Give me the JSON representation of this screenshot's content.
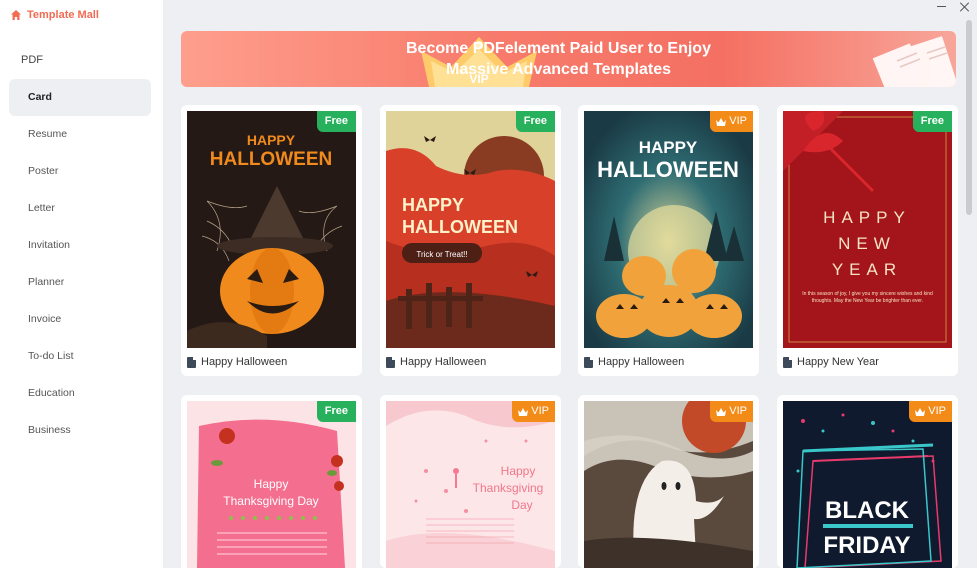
{
  "app": {
    "title": "Template Mall"
  },
  "sidebar": {
    "section": "PDF",
    "items": [
      {
        "label": "Card",
        "active": true
      },
      {
        "label": "Resume"
      },
      {
        "label": "Poster"
      },
      {
        "label": "Letter"
      },
      {
        "label": "Invitation"
      },
      {
        "label": "Planner"
      },
      {
        "label": "Invoice"
      },
      {
        "label": "To-do List"
      },
      {
        "label": "Education"
      },
      {
        "label": "Business"
      }
    ]
  },
  "banner": {
    "line1": "Become PDFelement Paid User to Enjoy",
    "line2": "Massive Advanced Templates",
    "crown_text": "VIP"
  },
  "badges": {
    "free": "Free",
    "vip": "VIP"
  },
  "cards": [
    {
      "title": "Happy Halloween",
      "badge": "Free",
      "art": {
        "line1": "HAPPY",
        "line2": "HALLOWEEN"
      }
    },
    {
      "title": "Happy Halloween",
      "badge": "Free",
      "art": {
        "line1": "HAPPY",
        "line2": "HALLOWEEN",
        "pill": "Trick or Treat!!"
      }
    },
    {
      "title": "Happy Halloween",
      "badge": "VIP",
      "art": {
        "line1": "HAPPY",
        "line2": "HALLOWEEN"
      }
    },
    {
      "title": "Happy New Year",
      "badge": "Free",
      "art": {
        "line1": "HAPPY",
        "line2": "NEW",
        "line3": "YEAR",
        "body": "In this season of joy, I give you my sincere wishes and kind thoughts. May the New Year be brighter than ever."
      }
    },
    {
      "title": "",
      "badge": "Free",
      "art": {
        "line1": "Happy",
        "line2": "Thanksgiving Day"
      }
    },
    {
      "title": "",
      "badge": "VIP",
      "art": {
        "line1": "Happy",
        "line2": "Thanksgiving",
        "line3": "Day"
      }
    },
    {
      "title": "",
      "badge": "VIP",
      "art": {}
    },
    {
      "title": "",
      "badge": "VIP",
      "art": {
        "line1": "BLACK",
        "line2": "FRIDAY"
      }
    }
  ],
  "colors": {
    "accent": "#f26b52",
    "free": "#27b15c",
    "vip": "#f38b18"
  }
}
